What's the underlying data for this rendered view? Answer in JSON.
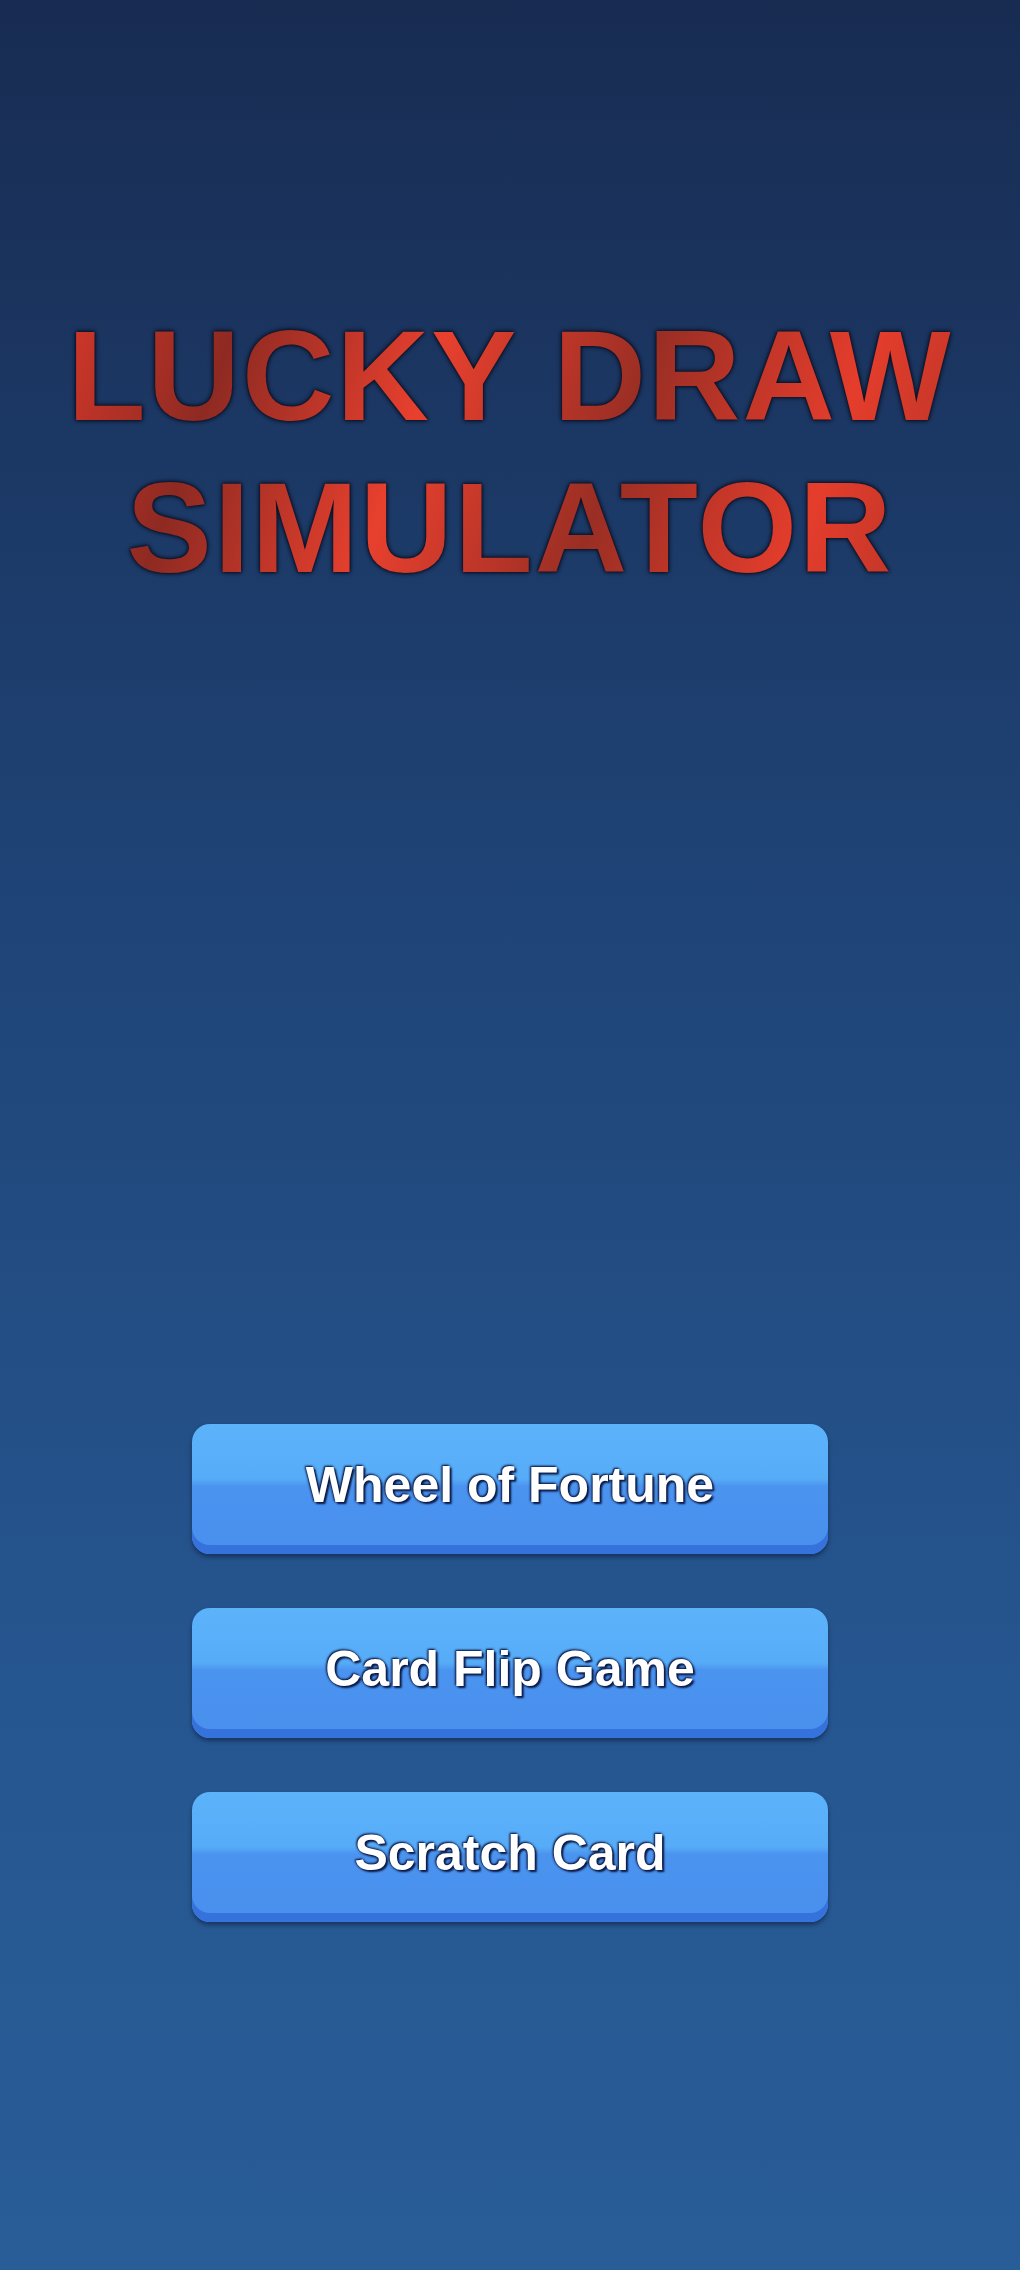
{
  "title": "LUCKY DRAW SIMULATOR",
  "menu_buttons": [
    {
      "label": "Wheel of Fortune"
    },
    {
      "label": "Card Flip Game"
    },
    {
      "label": "Scratch Card"
    }
  ]
}
